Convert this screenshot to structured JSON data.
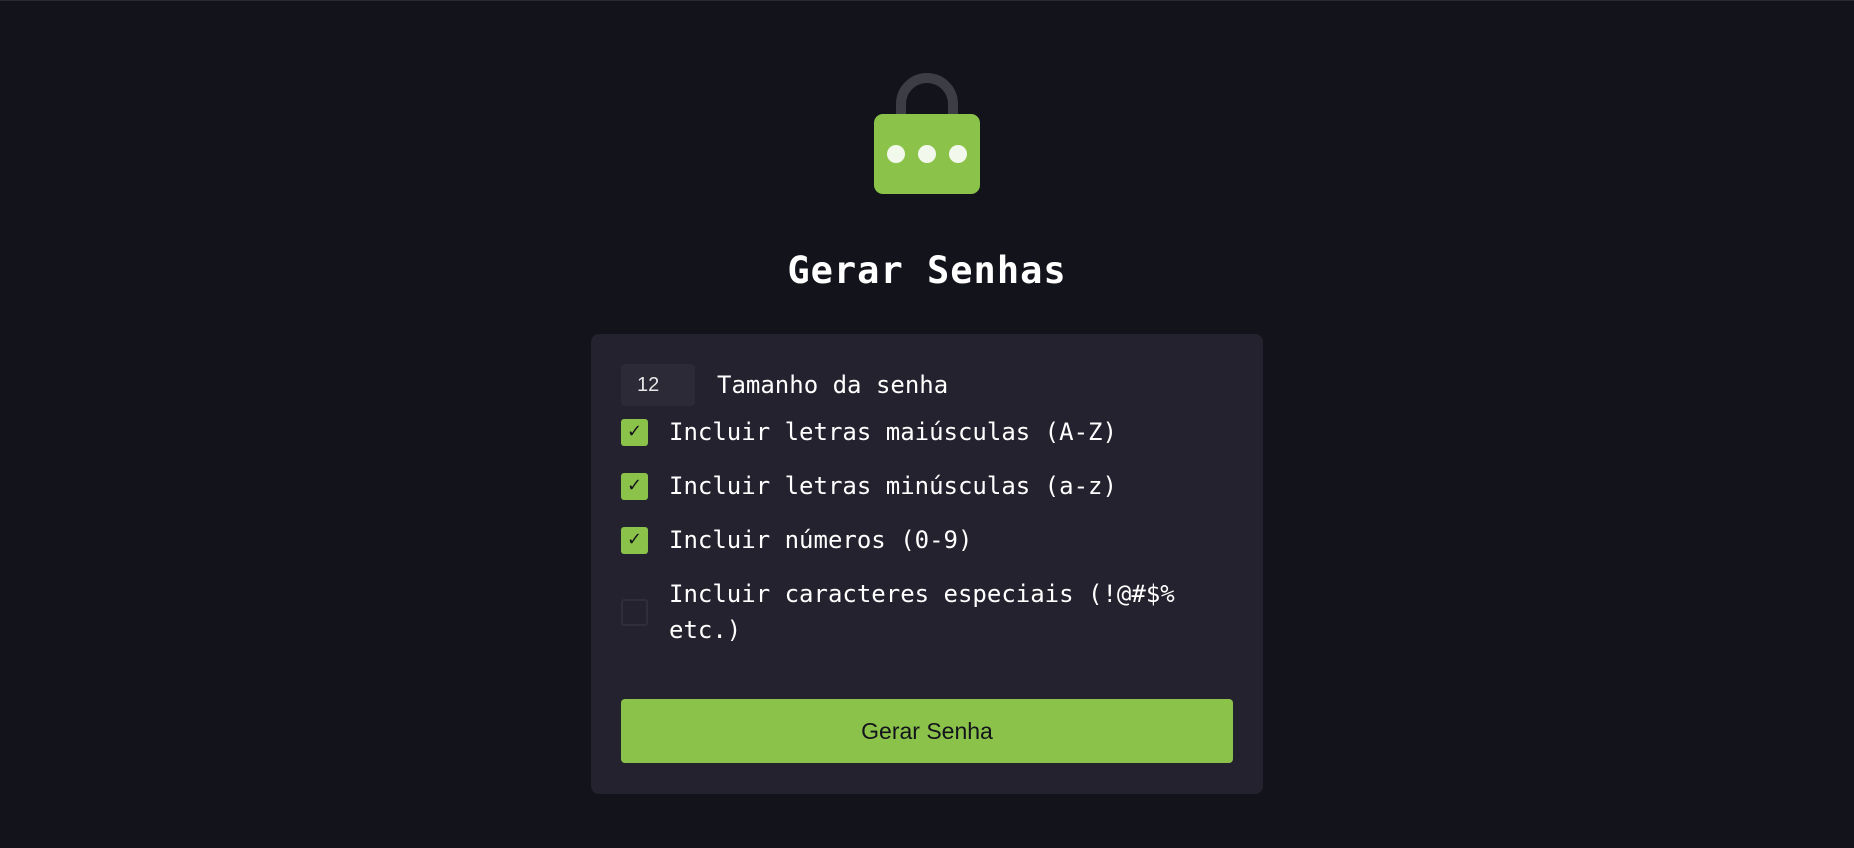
{
  "app": {
    "title": "Gerar Senhas",
    "accent_color": "#8bc34a",
    "background_color": "#13131c",
    "card_color": "#23222e",
    "logo_icon": "lock-icon"
  },
  "form": {
    "length": {
      "value": "12",
      "label": "Tamanho da senha"
    },
    "options": [
      {
        "label": "Incluir letras maiúsculas (A-Z)",
        "checked": true
      },
      {
        "label": "Incluir letras minúsculas (a-z)",
        "checked": true
      },
      {
        "label": "Incluir números (0-9)",
        "checked": true
      },
      {
        "label": "Incluir caracteres especiais (!@#$% etc.)",
        "checked": false
      }
    ],
    "check_glyph": "✓",
    "generate_label": "Gerar Senha"
  }
}
